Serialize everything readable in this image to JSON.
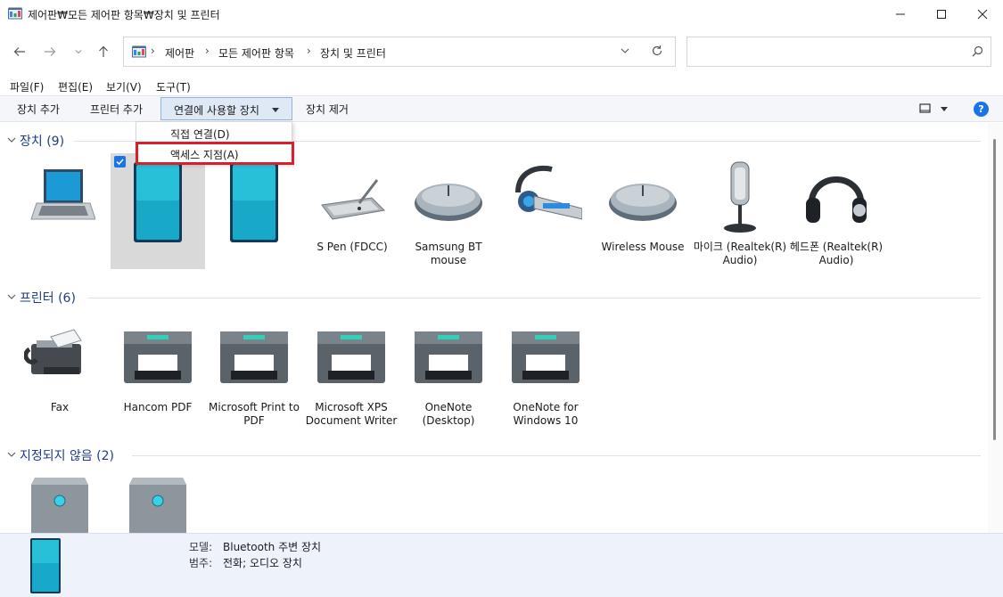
{
  "window": {
    "title": "제어판₩모든 제어판 항목₩장치 및 프린터"
  },
  "address": {
    "crumbs": [
      "제어판",
      "모든 제어판 항목",
      "장치 및 프린터"
    ]
  },
  "search": {
    "placeholder": "",
    "value": ""
  },
  "menu": [
    "파일(F)",
    "편집(E)",
    "보기(V)",
    "도구(T)"
  ],
  "toolbar": {
    "add_device": "장치 추가",
    "add_printer": "프린터 추가",
    "connect_using": "연결에 사용할 장치",
    "remove_device": "장치 제거",
    "help": "?"
  },
  "connect_menu": {
    "items": [
      "직접 연결(D)",
      "액세스 지점(A)"
    ]
  },
  "groups": {
    "devices": {
      "title": "장치 (9)"
    },
    "printers": {
      "title": "프린터 (6)"
    },
    "unspecified": {
      "title": "지정되지 않음 (2)"
    }
  },
  "devices": [
    {
      "label": "",
      "icon": "laptop-icon"
    },
    {
      "label": "",
      "icon": "phone-icon"
    },
    {
      "label": "",
      "icon": "phone-icon"
    },
    {
      "label": "S Pen (FDCC)",
      "icon": "pen-tablet-icon"
    },
    {
      "label": "Samsung BT mouse",
      "icon": "mouse-icon"
    },
    {
      "label": "",
      "icon": "headset-icon"
    },
    {
      "label": "Wireless Mouse",
      "icon": "mouse-icon"
    },
    {
      "label": "마이크 (Realtek(R) Audio)",
      "icon": "microphone-icon"
    },
    {
      "label": "헤드폰 (Realtek(R) Audio)",
      "icon": "headphones-icon"
    }
  ],
  "printers": [
    {
      "label": "Fax",
      "icon": "fax-icon"
    },
    {
      "label": "Hancom PDF",
      "icon": "printer-icon"
    },
    {
      "label": "Microsoft Print to PDF",
      "icon": "printer-icon"
    },
    {
      "label": "Microsoft XPS Document Writer",
      "icon": "printer-icon"
    },
    {
      "label": "OneNote (Desktop)",
      "icon": "printer-icon"
    },
    {
      "label": "OneNote for Windows 10",
      "icon": "printer-icon"
    }
  ],
  "details": {
    "model_label": "모델:",
    "model_value": "Bluetooth 주변 장치",
    "category_label": "범주:",
    "category_value": "전화; 오디오 장치"
  },
  "colors": {
    "accent": "#1a73e8",
    "group_title": "#1e3b8a",
    "highlight": "#d9202a"
  }
}
